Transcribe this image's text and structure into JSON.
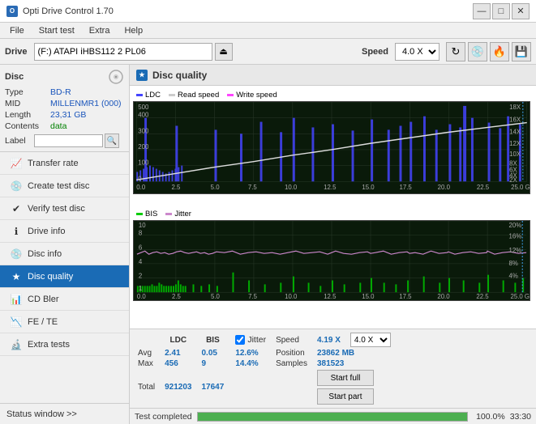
{
  "app": {
    "title": "Opti Drive Control 1.70",
    "icon": "O"
  },
  "titlebar": {
    "minimize": "—",
    "maximize": "□",
    "close": "✕"
  },
  "menubar": {
    "items": [
      "File",
      "Start test",
      "Extra",
      "Help"
    ]
  },
  "toolbar": {
    "drive_label": "Drive",
    "drive_value": "(F:)  ATAPI iHBS112  2 PL06",
    "speed_label": "Speed",
    "speed_value": "4.0 X"
  },
  "disc": {
    "header": "Disc",
    "type_label": "Type",
    "type_value": "BD-R",
    "mid_label": "MID",
    "mid_value": "MILLENMR1 (000)",
    "length_label": "Length",
    "length_value": "23,31 GB",
    "contents_label": "Contents",
    "contents_value": "data",
    "label_label": "Label",
    "label_value": ""
  },
  "nav": {
    "items": [
      {
        "id": "transfer-rate",
        "label": "Transfer rate",
        "icon": "📈"
      },
      {
        "id": "create-test-disc",
        "label": "Create test disc",
        "icon": "💿"
      },
      {
        "id": "verify-test-disc",
        "label": "Verify test disc",
        "icon": "✔"
      },
      {
        "id": "drive-info",
        "label": "Drive info",
        "icon": "ℹ"
      },
      {
        "id": "disc-info",
        "label": "Disc info",
        "icon": "💿"
      },
      {
        "id": "disc-quality",
        "label": "Disc quality",
        "icon": "★",
        "active": true
      },
      {
        "id": "cd-bler",
        "label": "CD Bler",
        "icon": "📊"
      },
      {
        "id": "fe-te",
        "label": "FE / TE",
        "icon": "📉"
      },
      {
        "id": "extra-tests",
        "label": "Extra tests",
        "icon": "🔬"
      }
    ]
  },
  "status_window": {
    "label": "Status window >> "
  },
  "disc_quality": {
    "title": "Disc quality",
    "icon": "★",
    "legend_top": {
      "ldc": {
        "label": "LDC",
        "color": "#4444ff"
      },
      "read": {
        "label": "Read speed",
        "color": "#cccccc"
      },
      "write": {
        "label": "Write speed",
        "color": "#ff44ff"
      }
    },
    "legend_bottom": {
      "bis": {
        "label": "BIS",
        "color": "#00cc00"
      },
      "jitter": {
        "label": "Jitter",
        "color": "#ccaacc"
      }
    }
  },
  "stats": {
    "headers": [
      "",
      "LDC",
      "BIS"
    ],
    "avg_label": "Avg",
    "avg_ldc": "2.41",
    "avg_bis": "0.05",
    "max_label": "Max",
    "max_ldc": "456",
    "max_bis": "9",
    "total_label": "Total",
    "total_ldc": "921203",
    "total_bis": "17647",
    "jitter_label": "Jitter",
    "jitter_checked": true,
    "jitter_avg": "12.6%",
    "jitter_max": "14.4%",
    "jitter_total": "",
    "speed_label": "Speed",
    "speed_value": "4.19 X",
    "speed_select": "4.0 X",
    "position_label": "Position",
    "position_value": "23862 MB",
    "samples_label": "Samples",
    "samples_value": "381523",
    "start_full": "Start full",
    "start_part": "Start part"
  },
  "progress": {
    "label": "Test completed",
    "percent": 100.0,
    "percent_display": "100.0%",
    "time": "33:30"
  }
}
